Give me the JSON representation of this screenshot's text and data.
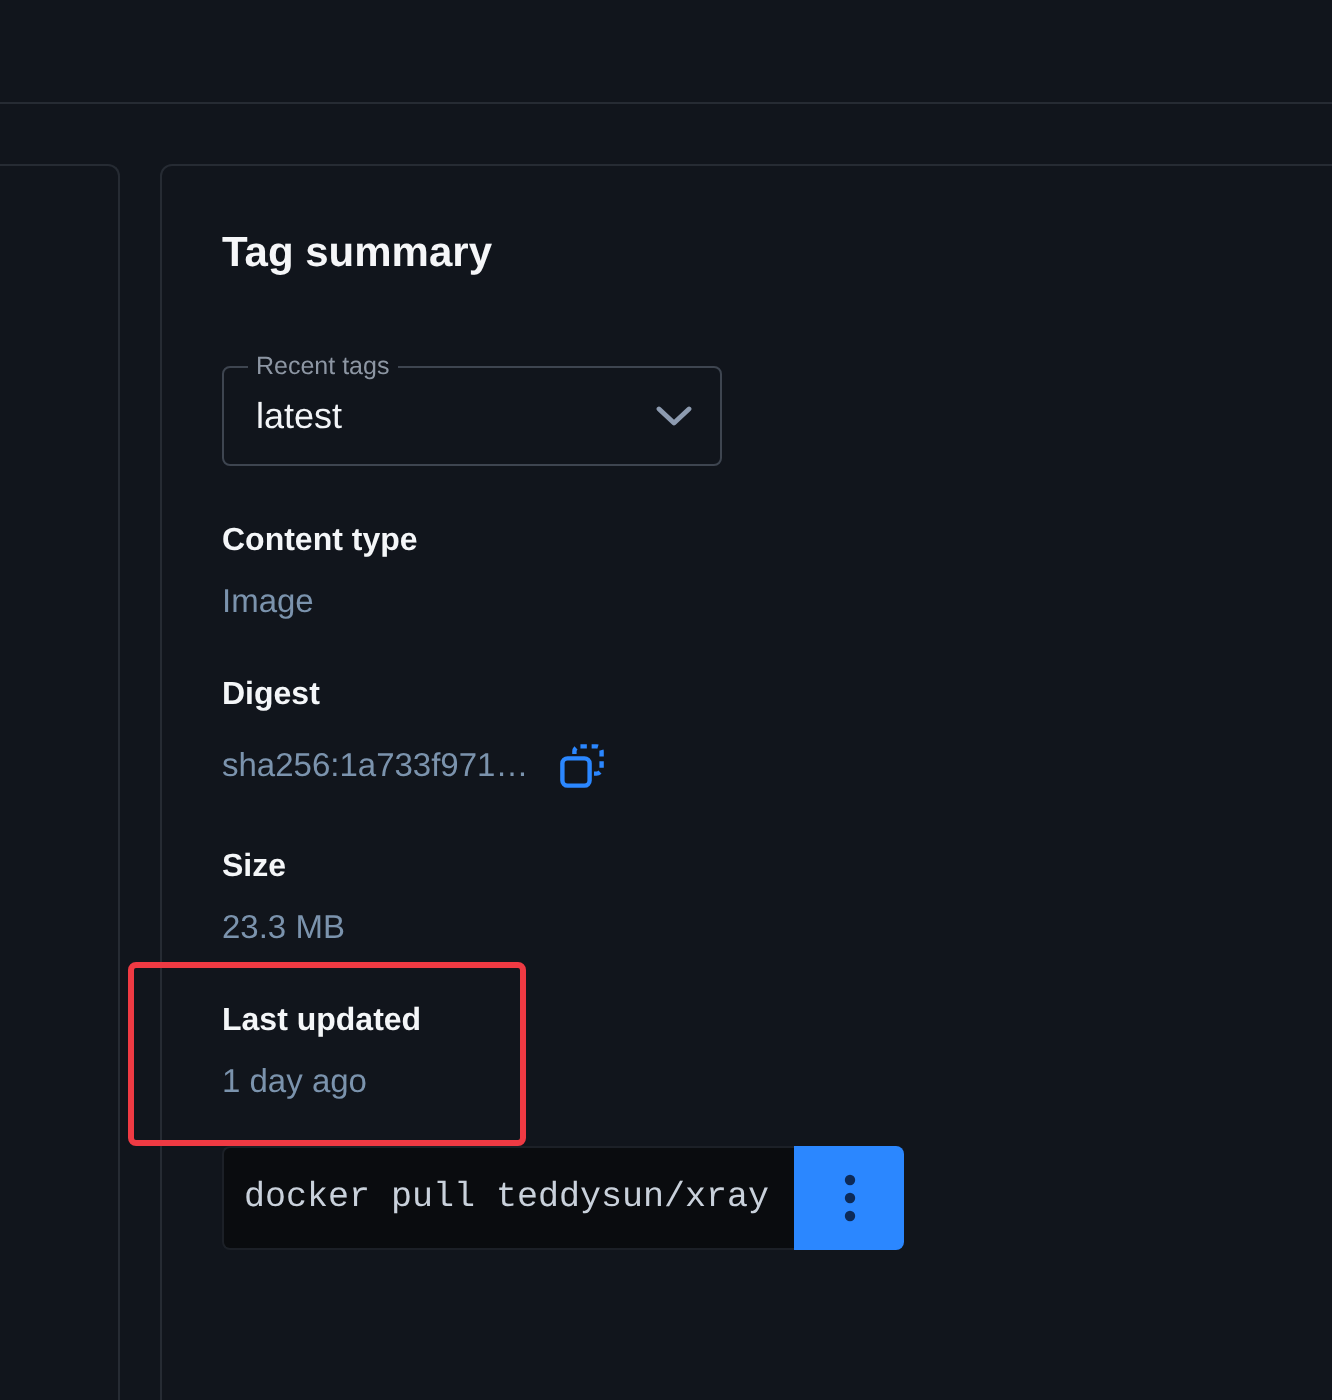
{
  "tag_summary": {
    "title": "Tag summary",
    "tag_select": {
      "label": "Recent tags",
      "value": "latest"
    },
    "details": [
      {
        "kind": "text",
        "label": "Content type",
        "value": "Image",
        "highlighted": false
      },
      {
        "kind": "copyable",
        "label": "Digest",
        "value": "sha256:1a733f971…",
        "highlighted": false
      },
      {
        "kind": "text",
        "label": "Size",
        "value": "23.3 MB",
        "highlighted": false
      },
      {
        "kind": "text",
        "label": "Last updated",
        "value": "1 day ago",
        "highlighted": true
      }
    ],
    "pull_command": {
      "command": "docker pull teddysun/xray"
    }
  }
}
